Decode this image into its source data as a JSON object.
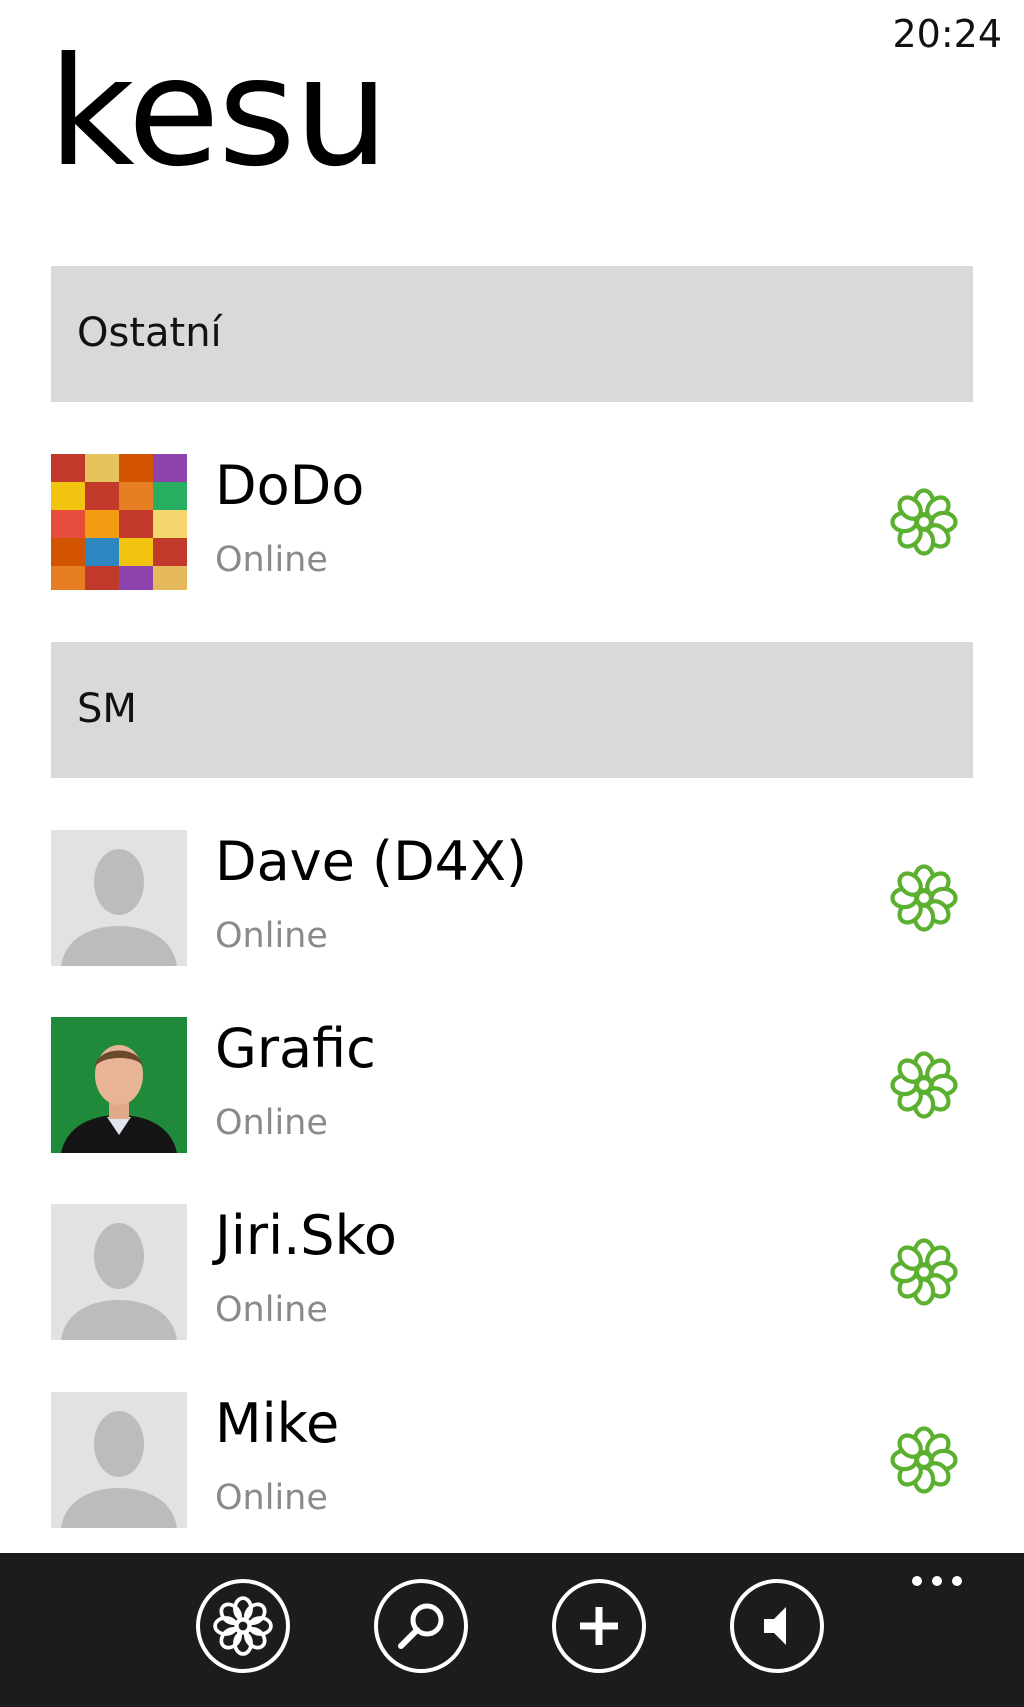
{
  "status_bar": {
    "time": "20:24"
  },
  "app": {
    "title": "kesu",
    "accent_color": "#5cb030"
  },
  "groups": [
    {
      "header": "Ostatní"
    },
    {
      "header": "SM"
    }
  ],
  "contacts": [
    {
      "name": "DoDo",
      "status": "Online",
      "group": "Ostatní",
      "avatar": "photo-colorful-fabric"
    },
    {
      "name": "Dave (D4X)",
      "status": "Online",
      "group": "SM",
      "avatar": "default-silhouette"
    },
    {
      "name": "Grafic",
      "status": "Online",
      "group": "SM",
      "avatar": "photo-person"
    },
    {
      "name": "Jiri.Sko",
      "status": "Online",
      "group": "SM",
      "avatar": "default-silhouette"
    },
    {
      "name": "Mike",
      "status": "Online",
      "group": "SM",
      "avatar": "default-silhouette"
    }
  ],
  "app_bar": {
    "buttons": [
      {
        "icon": "icq-flower-icon"
      },
      {
        "icon": "search-icon"
      },
      {
        "icon": "add-icon"
      },
      {
        "icon": "speaker-icon"
      }
    ],
    "more": "more-icon"
  }
}
